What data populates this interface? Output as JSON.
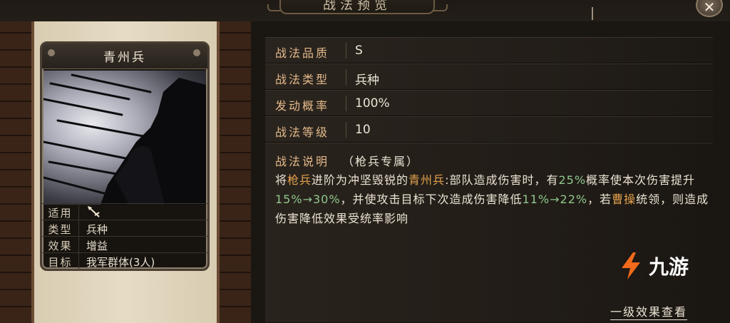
{
  "header": {
    "title": "战法预览",
    "close_label": "✕"
  },
  "card": {
    "name": "青州兵",
    "info": [
      {
        "key": "适用",
        "value": ""
      },
      {
        "key": "类型",
        "value": "兵种"
      },
      {
        "key": "效果",
        "value": "增益"
      },
      {
        "key": "目标",
        "value": "我军群体(3人)"
      }
    ]
  },
  "stats": [
    {
      "label": "战法品质",
      "value": "S"
    },
    {
      "label": "战法类型",
      "value": "兵种"
    },
    {
      "label": "发动概率",
      "value": "100%"
    },
    {
      "label": "战法等级",
      "value": "10"
    }
  ],
  "description": {
    "label": "战法说明",
    "tag": "（枪兵专属）",
    "segments": [
      {
        "t": "将",
        "c": "text"
      },
      {
        "t": "枪兵",
        "c": "hl"
      },
      {
        "t": "进阶为冲坚毁锐的",
        "c": "text"
      },
      {
        "t": "青州兵",
        "c": "hl"
      },
      {
        "t": ":部队造成伤害时，有",
        "c": "text"
      },
      {
        "t": "25%",
        "c": "num"
      },
      {
        "t": "概率使本次伤害提升",
        "c": "text"
      },
      {
        "t": "15%→30%",
        "c": "num"
      },
      {
        "t": "，并使攻击目标下次造成伤害降低",
        "c": "text"
      },
      {
        "t": "11%→22%",
        "c": "num"
      },
      {
        "t": "，若",
        "c": "text"
      },
      {
        "t": "曹操",
        "c": "hl"
      },
      {
        "t": "统领，则造成伤害降低效果受统率影响",
        "c": "text"
      }
    ]
  },
  "footer": {
    "link_label": "一级效果查看"
  },
  "watermark": {
    "text": "九游"
  },
  "colors": {
    "label": "#e3b98a",
    "highlight": "#e3a34e",
    "number": "#8fc78d",
    "text": "#ece4d4"
  }
}
